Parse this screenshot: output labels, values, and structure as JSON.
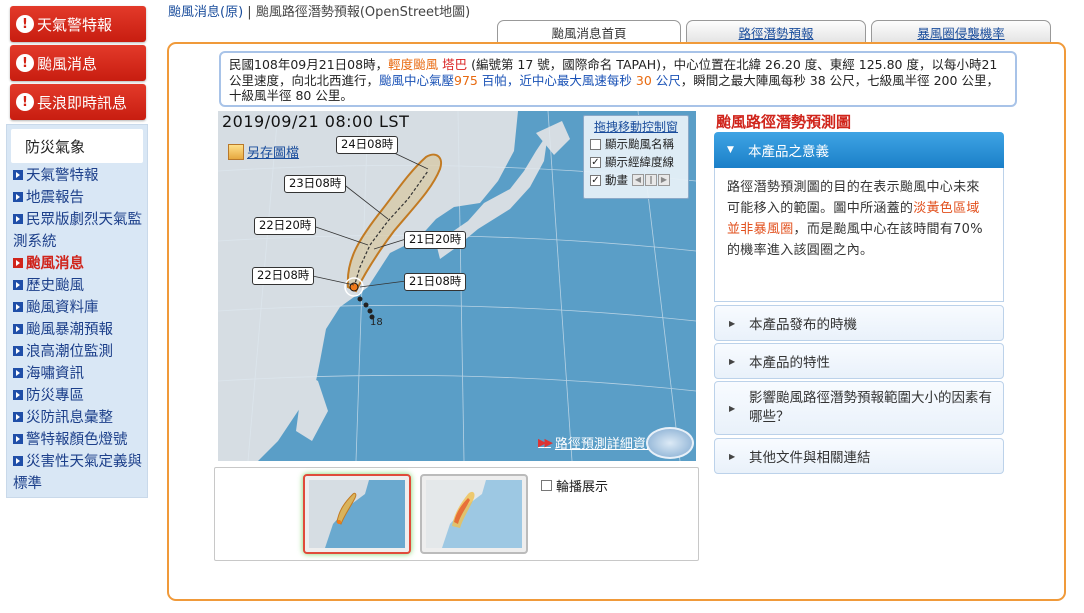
{
  "sidebar": {
    "alerts": [
      {
        "label": "天氣警特報"
      },
      {
        "label": "颱風消息"
      },
      {
        "label": "長浪即時訊息"
      }
    ],
    "section_title": "防災氣象",
    "items": [
      {
        "label": "天氣警特報"
      },
      {
        "label": "地震報告"
      },
      {
        "label": "民眾版劇烈天氣監測系統"
      },
      {
        "label": "颱風消息",
        "active": true
      },
      {
        "label": "歷史颱風"
      },
      {
        "label": "颱風資料庫"
      },
      {
        "label": "颱風暴潮預報"
      },
      {
        "label": "浪高潮位監測"
      },
      {
        "label": "海嘯資訊"
      },
      {
        "label": "防災專區"
      },
      {
        "label": "災防訊息彙整"
      },
      {
        "label": "警特報顏色燈號"
      },
      {
        "label": "災害性天氣定義與標準"
      }
    ]
  },
  "breadcrumb": {
    "link": "颱風消息(原)",
    "separator": "|",
    "current": "颱風路徑潛勢預報(OpenStreet地圖)"
  },
  "tabs": [
    {
      "label": "颱風消息首頁",
      "active": true
    },
    {
      "label": "路徑潛勢預報",
      "active": false
    },
    {
      "label": "暴風圈侵襲機率",
      "active": false
    }
  ],
  "info": {
    "p1": "民國108年09月21日08時，",
    "type": "輕度颱風",
    "name": "塔巴",
    "p2": "(編號第 17 號，國際命名 TAPAH)，中心位置在北緯 26.20 度、東經 125.80 度，以每小時21公里速度，向北北西進行，",
    "p3": "颱風中心氣壓",
    "pressure": "975",
    "p4": "百帕，近中心最大風速每秒",
    "wind": "30",
    "p5": "公尺",
    "p6": "，瞬間之最大陣風每秒 38 公尺，七級風半徑 200 公里，十級風半徑 80 公里。"
  },
  "map": {
    "timestamp": "2019/09/21 08:00 LST",
    "save_label": "另存圖檔",
    "forecast_labels": [
      "24日08時",
      "23日08時",
      "22日20時",
      "21日20時",
      "22日08時",
      "21日08時"
    ],
    "past_label": "18",
    "control": {
      "title": "拖拽移動控制窗",
      "options": [
        {
          "label": "顯示颱風名稱",
          "checked": false
        },
        {
          "label": "顯示經緯度線",
          "checked": true
        },
        {
          "label": "動畫",
          "checked": true
        }
      ]
    },
    "detail_link": "路徑預測詳細資訊",
    "colors": {
      "sea": "#5a9ec7",
      "land": "#d6dde3",
      "cone": "#d98a2b"
    }
  },
  "thumbs": {
    "rotate_label": "輪播展示",
    "rotate_checked": false
  },
  "right": {
    "title": "颱風路徑潛勢預測圖",
    "open_section": "本產品之意義",
    "body_1": "路徑潛勢預測圖的目的在表示颱風中心未來可能移入的範圍。圖中所涵蓋的",
    "body_hl": "淡黃色區域並非暴風圈",
    "body_2": "，而是颱風中心在該時間有70%的機率進入該圓圈之內。",
    "sections": [
      {
        "label": "本產品發布的時機"
      },
      {
        "label": "本產品的特性"
      },
      {
        "label": "影響颱風路徑潛勢預報範圍大小的因素有哪些？"
      },
      {
        "label": "其他文件與相關連結"
      }
    ]
  }
}
